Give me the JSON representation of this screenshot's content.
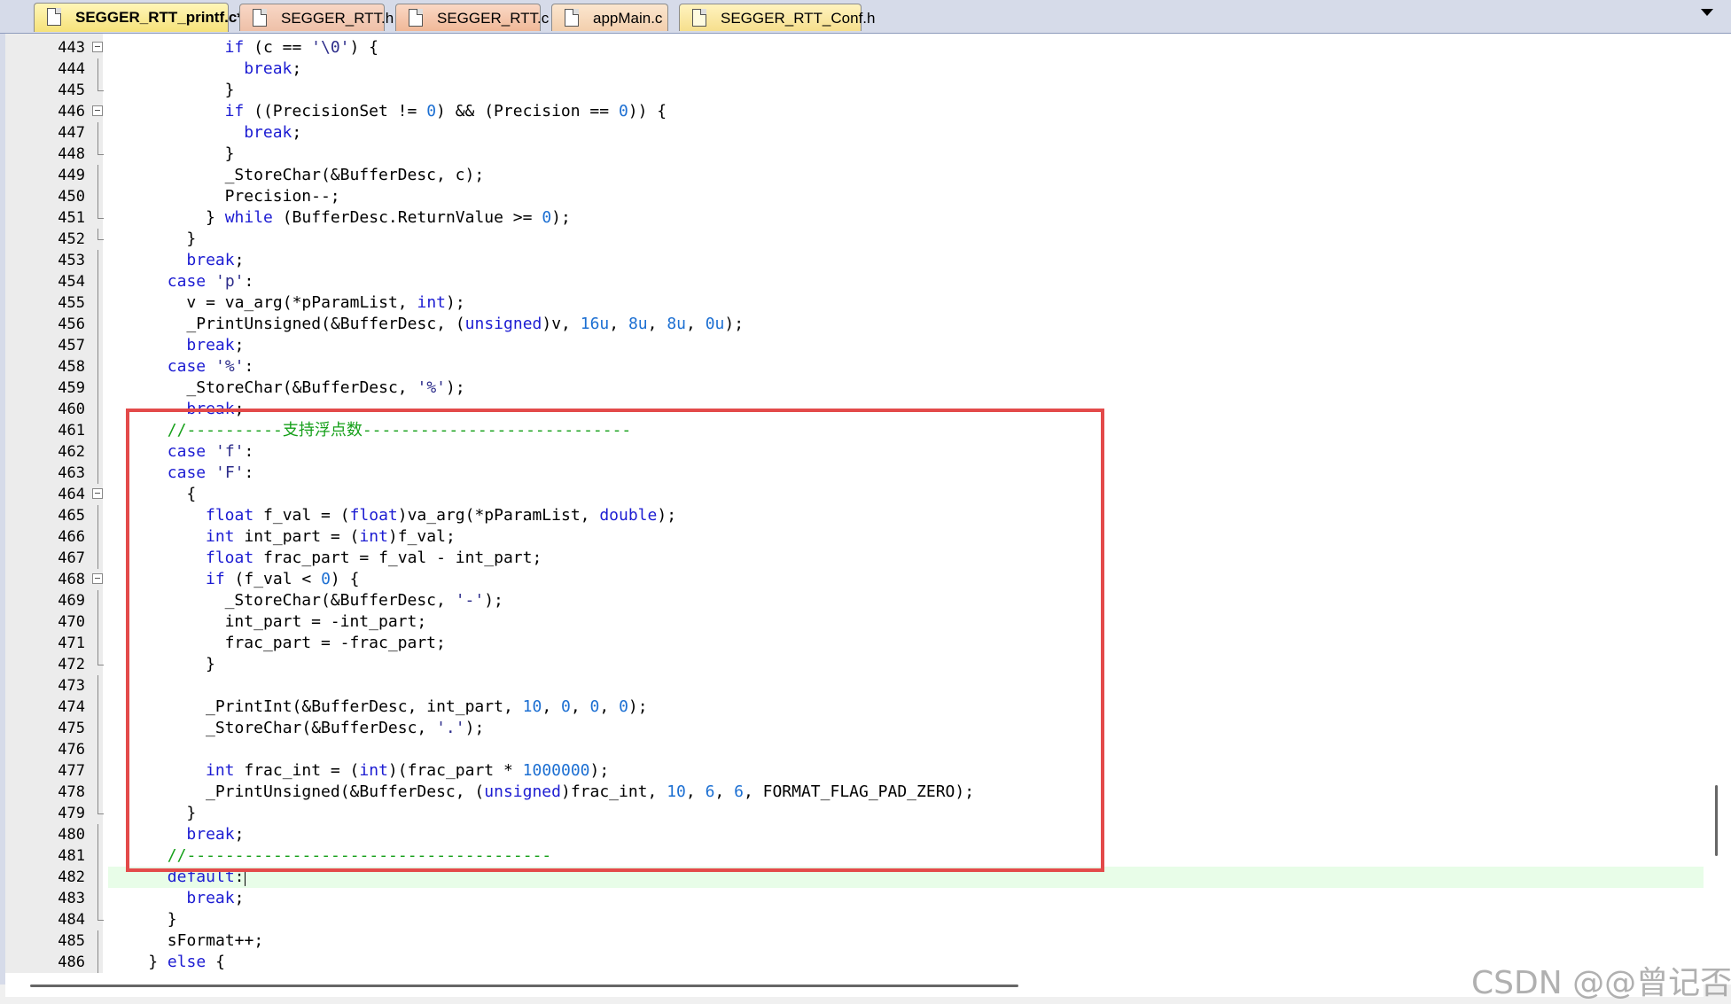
{
  "tabs": [
    {
      "label": "SEGGER_RTT_printf.c*",
      "active": true
    },
    {
      "label": "SEGGER_RTT.h",
      "active": false
    },
    {
      "label": "SEGGER_RTT.c",
      "active": false
    },
    {
      "label": "appMain.c",
      "active": false
    },
    {
      "label": "SEGGER_RTT_Conf.h",
      "active": false
    }
  ],
  "colors": {
    "keyword": "#1c1cd2",
    "number": "#1c6fd2",
    "comment": "#16a01a",
    "highlight_box": "#e34a4a",
    "current_line": "#e8fde8"
  },
  "editor": {
    "current_line": 482,
    "lines": [
      {
        "n": 443,
        "fold": "box",
        "indent": 12,
        "parts": [
          [
            "kw",
            "if"
          ],
          [
            "",
            " (c == "
          ],
          [
            "str",
            "'\\0'"
          ],
          [
            "",
            ") {"
          ]
        ]
      },
      {
        "n": 444,
        "fold": "bar",
        "indent": 14,
        "parts": [
          [
            "kw",
            "break"
          ],
          [
            "",
            ";"
          ]
        ]
      },
      {
        "n": 445,
        "fold": "end",
        "indent": 12,
        "parts": [
          [
            "",
            "}"
          ]
        ]
      },
      {
        "n": 446,
        "fold": "box",
        "indent": 12,
        "parts": [
          [
            "kw",
            "if"
          ],
          [
            "",
            " ((PrecisionSet != "
          ],
          [
            "num",
            "0"
          ],
          [
            "",
            ") && (Precision == "
          ],
          [
            "num",
            "0"
          ],
          [
            "",
            ")) {"
          ]
        ]
      },
      {
        "n": 447,
        "fold": "bar",
        "indent": 14,
        "parts": [
          [
            "kw",
            "break"
          ],
          [
            "",
            ";"
          ]
        ]
      },
      {
        "n": 448,
        "fold": "end",
        "indent": 12,
        "parts": [
          [
            "",
            "}"
          ]
        ]
      },
      {
        "n": 449,
        "fold": "bar",
        "indent": 12,
        "parts": [
          [
            "",
            "_StoreChar(&BufferDesc, c);"
          ]
        ]
      },
      {
        "n": 450,
        "fold": "bar",
        "indent": 12,
        "parts": [
          [
            "",
            "Precision--;"
          ]
        ]
      },
      {
        "n": 451,
        "fold": "end",
        "indent": 10,
        "parts": [
          [
            "",
            "} "
          ],
          [
            "kw",
            "while"
          ],
          [
            "",
            " (BufferDesc.ReturnValue >= "
          ],
          [
            "num",
            "0"
          ],
          [
            "",
            ");"
          ]
        ]
      },
      {
        "n": 452,
        "fold": "end",
        "indent": 8,
        "parts": [
          [
            "",
            "}"
          ]
        ]
      },
      {
        "n": 453,
        "fold": "bar",
        "indent": 8,
        "parts": [
          [
            "kw",
            "break"
          ],
          [
            "",
            ";"
          ]
        ]
      },
      {
        "n": 454,
        "fold": "bar",
        "indent": 6,
        "parts": [
          [
            "kw",
            "case"
          ],
          [
            "",
            " "
          ],
          [
            "str",
            "'p'"
          ],
          [
            "",
            ":"
          ]
        ]
      },
      {
        "n": 455,
        "fold": "bar",
        "indent": 8,
        "parts": [
          [
            "",
            "v = va_arg(*pParamList, "
          ],
          [
            "kw",
            "int"
          ],
          [
            "",
            ");"
          ]
        ]
      },
      {
        "n": 456,
        "fold": "bar",
        "indent": 8,
        "parts": [
          [
            "",
            "_PrintUnsigned(&BufferDesc, ("
          ],
          [
            "kw",
            "unsigned"
          ],
          [
            "",
            ")v, "
          ],
          [
            "num",
            "16u"
          ],
          [
            "",
            ", "
          ],
          [
            "num",
            "8u"
          ],
          [
            "",
            ", "
          ],
          [
            "num",
            "8u"
          ],
          [
            "",
            ", "
          ],
          [
            "num",
            "0u"
          ],
          [
            "",
            ");"
          ]
        ]
      },
      {
        "n": 457,
        "fold": "bar",
        "indent": 8,
        "parts": [
          [
            "kw",
            "break"
          ],
          [
            "",
            ";"
          ]
        ]
      },
      {
        "n": 458,
        "fold": "bar",
        "indent": 6,
        "parts": [
          [
            "kw",
            "case"
          ],
          [
            "",
            " "
          ],
          [
            "str",
            "'%'"
          ],
          [
            "",
            ":"
          ]
        ]
      },
      {
        "n": 459,
        "fold": "bar",
        "indent": 8,
        "parts": [
          [
            "",
            "_StoreChar(&BufferDesc, "
          ],
          [
            "str",
            "'%'"
          ],
          [
            "",
            ");"
          ]
        ]
      },
      {
        "n": 460,
        "fold": "bar",
        "indent": 8,
        "parts": [
          [
            "kw",
            "break"
          ],
          [
            "",
            ";"
          ]
        ]
      },
      {
        "n": 461,
        "fold": "bar",
        "indent": 6,
        "parts": [
          [
            "cm",
            "//----------支持浮点数----------------------------"
          ]
        ]
      },
      {
        "n": 462,
        "fold": "bar",
        "indent": 6,
        "parts": [
          [
            "kw",
            "case"
          ],
          [
            "",
            " "
          ],
          [
            "str",
            "'f'"
          ],
          [
            "",
            ":"
          ]
        ]
      },
      {
        "n": 463,
        "fold": "bar",
        "indent": 6,
        "parts": [
          [
            "kw",
            "case"
          ],
          [
            "",
            " "
          ],
          [
            "str",
            "'F'"
          ],
          [
            "",
            ":"
          ]
        ]
      },
      {
        "n": 464,
        "fold": "box",
        "indent": 8,
        "parts": [
          [
            "",
            "{"
          ]
        ]
      },
      {
        "n": 465,
        "fold": "bar",
        "indent": 10,
        "parts": [
          [
            "kw",
            "float"
          ],
          [
            "",
            " f_val = ("
          ],
          [
            "kw",
            "float"
          ],
          [
            "",
            ")va_arg(*pParamList, "
          ],
          [
            "kw",
            "double"
          ],
          [
            "",
            ");"
          ]
        ]
      },
      {
        "n": 466,
        "fold": "bar",
        "indent": 10,
        "parts": [
          [
            "kw",
            "int"
          ],
          [
            "",
            " int_part = ("
          ],
          [
            "kw",
            "int"
          ],
          [
            "",
            ")f_val;"
          ]
        ]
      },
      {
        "n": 467,
        "fold": "bar",
        "indent": 10,
        "parts": [
          [
            "kw",
            "float"
          ],
          [
            "",
            " frac_part = f_val - int_part;"
          ]
        ]
      },
      {
        "n": 468,
        "fold": "box",
        "indent": 10,
        "parts": [
          [
            "kw",
            "if"
          ],
          [
            "",
            " (f_val < "
          ],
          [
            "num",
            "0"
          ],
          [
            "",
            ") {"
          ]
        ]
      },
      {
        "n": 469,
        "fold": "bar",
        "indent": 12,
        "parts": [
          [
            "",
            "_StoreChar(&BufferDesc, "
          ],
          [
            "str",
            "'-'"
          ],
          [
            "",
            ");"
          ]
        ]
      },
      {
        "n": 470,
        "fold": "bar",
        "indent": 12,
        "parts": [
          [
            "",
            "int_part = -int_part;"
          ]
        ]
      },
      {
        "n": 471,
        "fold": "bar",
        "indent": 12,
        "parts": [
          [
            "",
            "frac_part = -frac_part;"
          ]
        ]
      },
      {
        "n": 472,
        "fold": "end",
        "indent": 10,
        "parts": [
          [
            "",
            "}"
          ]
        ]
      },
      {
        "n": 473,
        "fold": "bar",
        "indent": 0,
        "parts": []
      },
      {
        "n": 474,
        "fold": "bar",
        "indent": 10,
        "parts": [
          [
            "",
            "_PrintInt(&BufferDesc, int_part, "
          ],
          [
            "num",
            "10"
          ],
          [
            "",
            ", "
          ],
          [
            "num",
            "0"
          ],
          [
            "",
            ", "
          ],
          [
            "num",
            "0"
          ],
          [
            "",
            ", "
          ],
          [
            "num",
            "0"
          ],
          [
            "",
            ");"
          ]
        ]
      },
      {
        "n": 475,
        "fold": "bar",
        "indent": 10,
        "parts": [
          [
            "",
            "_StoreChar(&BufferDesc, "
          ],
          [
            "str",
            "'.'"
          ],
          [
            "",
            ");"
          ]
        ]
      },
      {
        "n": 476,
        "fold": "bar",
        "indent": 0,
        "parts": []
      },
      {
        "n": 477,
        "fold": "bar",
        "indent": 10,
        "parts": [
          [
            "kw",
            "int"
          ],
          [
            "",
            " frac_int = ("
          ],
          [
            "kw",
            "int"
          ],
          [
            "",
            ")(frac_part * "
          ],
          [
            "num",
            "1000000"
          ],
          [
            "",
            ");"
          ]
        ]
      },
      {
        "n": 478,
        "fold": "bar",
        "indent": 10,
        "parts": [
          [
            "",
            "_PrintUnsigned(&BufferDesc, ("
          ],
          [
            "kw",
            "unsigned"
          ],
          [
            "",
            ")frac_int, "
          ],
          [
            "num",
            "10"
          ],
          [
            "",
            ", "
          ],
          [
            "num",
            "6"
          ],
          [
            "",
            ", "
          ],
          [
            "num",
            "6"
          ],
          [
            "",
            ", FORMAT_FLAG_PAD_ZERO);"
          ]
        ]
      },
      {
        "n": 479,
        "fold": "end",
        "indent": 8,
        "parts": [
          [
            "",
            "}"
          ]
        ]
      },
      {
        "n": 480,
        "fold": "bar",
        "indent": 8,
        "parts": [
          [
            "kw",
            "break"
          ],
          [
            "",
            ";"
          ]
        ]
      },
      {
        "n": 481,
        "fold": "bar",
        "indent": 6,
        "parts": [
          [
            "cm",
            "//--------------------------------------"
          ]
        ]
      },
      {
        "n": 482,
        "fold": "bar",
        "indent": 6,
        "parts": [
          [
            "kw",
            "default"
          ],
          [
            "",
            ":"
          ]
        ],
        "caret": true
      },
      {
        "n": 483,
        "fold": "bar",
        "indent": 8,
        "parts": [
          [
            "kw",
            "break"
          ],
          [
            "",
            ";"
          ]
        ]
      },
      {
        "n": 484,
        "fold": "end",
        "indent": 6,
        "parts": [
          [
            "",
            "}"
          ]
        ]
      },
      {
        "n": 485,
        "fold": "bar",
        "indent": 6,
        "parts": [
          [
            "",
            "sFormat++;"
          ]
        ]
      },
      {
        "n": 486,
        "fold": "bar",
        "indent": 4,
        "parts": [
          [
            "",
            "} "
          ],
          [
            "kw",
            "else"
          ],
          [
            "",
            " {"
          ]
        ]
      }
    ]
  },
  "watermark": "CSDN @@曾记否"
}
